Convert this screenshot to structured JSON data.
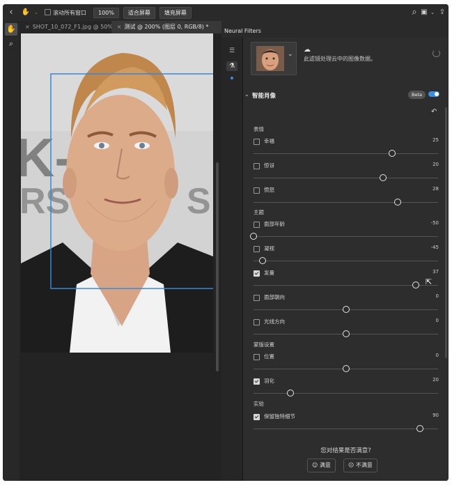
{
  "options_bar": {
    "scroll_all_label": "滚动所有窗口",
    "zoom_100": "100%",
    "fit_screen": "适合屏幕",
    "fill_screen": "填充屏幕"
  },
  "tabs": [
    {
      "label": "SHOT_10_072_F1.jpg @ 50%(R..."
    },
    {
      "label": "测试 @ 200% (图层 0, RGB/8) *"
    }
  ],
  "panel": {
    "title": "Neural Filters",
    "cloud_text": "此滤镜处理云中的图像数据。",
    "filter_name": "智能肖像",
    "beta_label": "Beta",
    "enabled": true
  },
  "categories": {
    "expression": "表情",
    "theme": "主题",
    "mask": "蒙版设置",
    "experimental": "实验"
  },
  "sliders": [
    {
      "label": "幸福",
      "value": "25",
      "fraction": 0.75,
      "checked": false
    },
    {
      "label": "惊讶",
      "value": "20",
      "fraction": 0.7,
      "checked": false
    },
    {
      "label": "愤怒",
      "value": "28",
      "fraction": 0.78,
      "checked": false
    },
    {
      "label": "面部年龄",
      "value": "-50",
      "fraction": 0.0,
      "checked": false
    },
    {
      "label": "凝视",
      "value": "-45",
      "fraction": 0.05,
      "checked": false
    },
    {
      "label": "发量",
      "value": "37",
      "fraction": 0.88,
      "checked": true
    },
    {
      "label": "面部朝向",
      "value": "0",
      "fraction": 0.5,
      "checked": false
    },
    {
      "label": "光线方向",
      "value": "0",
      "fraction": 0.5,
      "checked": false
    },
    {
      "label": "位置",
      "value": "0",
      "fraction": 0.5,
      "checked": false
    },
    {
      "label": "羽化",
      "value": "20",
      "fraction": 0.2,
      "checked": true
    },
    {
      "label": "保留独特细节",
      "value": "90",
      "fraction": 0.9,
      "checked": true
    }
  ],
  "feedback": {
    "question": "您对结果是否满意?",
    "satisfied": "满意",
    "unsatisfied": "不满意"
  },
  "colors": {
    "accent": "#3a8de0",
    "selection_box": "#3a86d8"
  }
}
